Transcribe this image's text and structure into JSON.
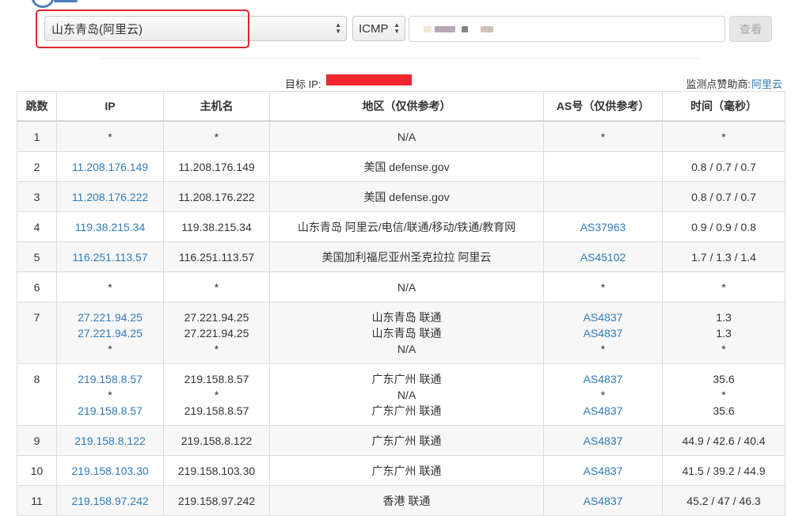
{
  "toolbar": {
    "node_value": "山东青岛(阿里云)",
    "protocol_value": "ICMP",
    "view_label": "查看"
  },
  "info": {
    "target_label": "目标 IP:",
    "sponsor_label": "监测点赞助商:",
    "sponsor_name": "阿里云"
  },
  "colors": {
    "link": "#2f7ab8",
    "highlight": "#e0262c",
    "redaction": "#f2262c"
  },
  "table": {
    "headers": [
      "跳数",
      "IP",
      "主机名",
      "地区（仅供参考）",
      "AS号（仅供参考）",
      "时间（毫秒）"
    ],
    "rows": [
      {
        "hop": "1",
        "ip": [
          "*"
        ],
        "host": [
          "*"
        ],
        "region": [
          "N/A"
        ],
        "as": [
          "*"
        ],
        "time": [
          "*"
        ]
      },
      {
        "hop": "2",
        "ip": [
          "11.208.176.149"
        ],
        "host": [
          "11.208.176.149"
        ],
        "region": [
          "美国 defense.gov"
        ],
        "as": [
          ""
        ],
        "time": [
          "0.8 / 0.7 / 0.7"
        ]
      },
      {
        "hop": "3",
        "ip": [
          "11.208.176.222"
        ],
        "host": [
          "11.208.176.222"
        ],
        "region": [
          "美国 defense.gov"
        ],
        "as": [
          ""
        ],
        "time": [
          "0.8 / 0.7 / 0.7"
        ]
      },
      {
        "hop": "4",
        "ip": [
          "119.38.215.34"
        ],
        "host": [
          "119.38.215.34"
        ],
        "region": [
          "山东青岛 阿里云/电信/联通/移动/铁通/教育网"
        ],
        "as": [
          "AS37963"
        ],
        "time": [
          "0.9 / 0.9 / 0.8"
        ]
      },
      {
        "hop": "5",
        "ip": [
          "116.251.113.57"
        ],
        "host": [
          "116.251.113.57"
        ],
        "region": [
          "美国加利福尼亚州圣克拉拉 阿里云"
        ],
        "as": [
          "AS45102"
        ],
        "time": [
          "1.7 / 1.3 / 1.4"
        ]
      },
      {
        "hop": "6",
        "ip": [
          "*"
        ],
        "host": [
          "*"
        ],
        "region": [
          "N/A"
        ],
        "as": [
          "*"
        ],
        "time": [
          "*"
        ]
      },
      {
        "hop": "7",
        "ip": [
          "27.221.94.25",
          "27.221.94.25",
          "*"
        ],
        "host": [
          "27.221.94.25",
          "27.221.94.25",
          "*"
        ],
        "region": [
          "山东青岛 联通",
          "山东青岛 联通",
          "N/A"
        ],
        "as": [
          "AS4837",
          "AS4837",
          "*"
        ],
        "time": [
          "1.3",
          "1.3",
          "*"
        ]
      },
      {
        "hop": "8",
        "ip": [
          "219.158.8.57",
          "*",
          "219.158.8.57"
        ],
        "host": [
          "219.158.8.57",
          "*",
          "219.158.8.57"
        ],
        "region": [
          "广东广州 联通",
          "N/A",
          "广东广州 联通"
        ],
        "as": [
          "AS4837",
          "*",
          "AS4837"
        ],
        "time": [
          "35.6",
          "*",
          "35.6"
        ]
      },
      {
        "hop": "9",
        "ip": [
          "219.158.8.122"
        ],
        "host": [
          "219.158.8.122"
        ],
        "region": [
          "广东广州 联通"
        ],
        "as": [
          "AS4837"
        ],
        "time": [
          "44.9 / 42.6 / 40.4"
        ]
      },
      {
        "hop": "10",
        "ip": [
          "219.158.103.30"
        ],
        "host": [
          "219.158.103.30"
        ],
        "region": [
          "广东广州 联通"
        ],
        "as": [
          "AS4837"
        ],
        "time": [
          "41.5 / 39.2 / 44.9"
        ]
      },
      {
        "hop": "11",
        "ip": [
          "219.158.97.242"
        ],
        "host": [
          "219.158.97.242"
        ],
        "region": [
          "香港 联通"
        ],
        "as": [
          "AS4837"
        ],
        "time": [
          "45.2 / 47 / 46.3"
        ]
      }
    ]
  }
}
